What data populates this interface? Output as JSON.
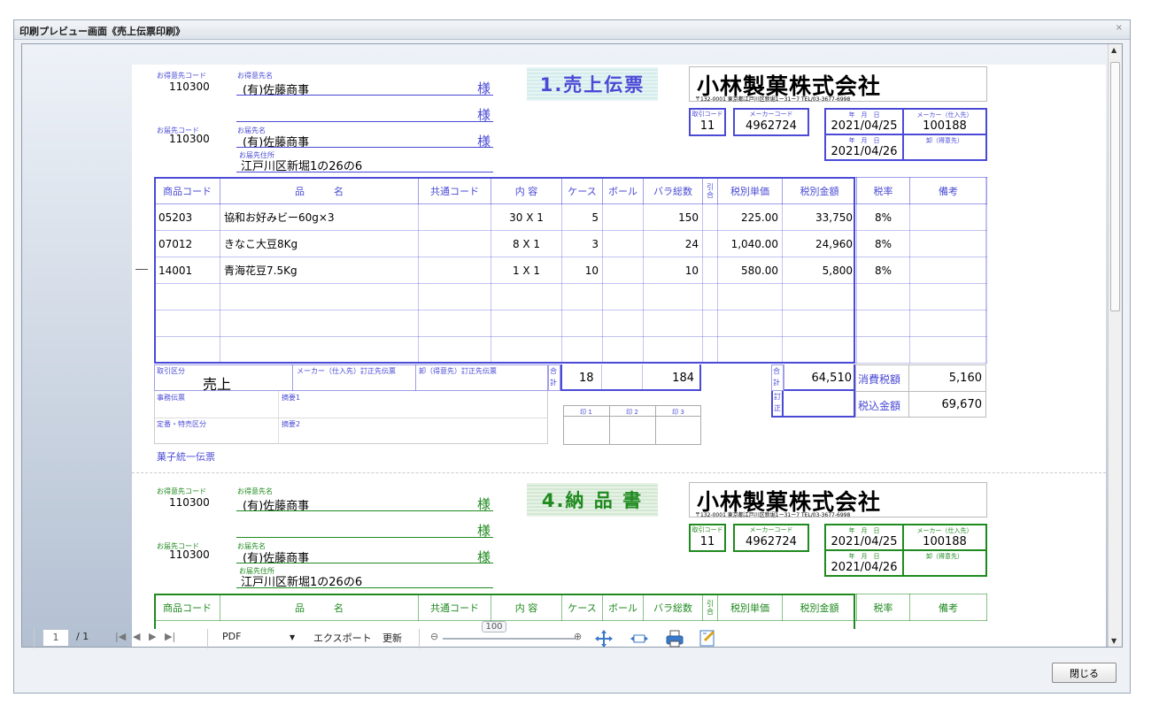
{
  "window": {
    "title": "印刷プレビュー画面《売上伝票印刷》",
    "close_icon": "×"
  },
  "slip1": {
    "color": "#4a4ad6",
    "title": "1.売上伝票",
    "tokuisaki_code_label": "お得意先コード",
    "tokuisaki_code": "110300",
    "tokuisaki_name_label": "お得意先名",
    "tokuisaki_name": "(有)佐藤商事",
    "sama": "様",
    "todoke_code_label": "お届先コード",
    "todoke_code": "110300",
    "todoke_name_label": "お届先名",
    "todoke_name": "(有)佐藤商事",
    "todoke_address_label": "お届先住所",
    "todoke_address": "江戸川区新堀1の26の6",
    "company_name": "小林製菓株式会社",
    "company_address": "〒132-0001 東京都江戸川区新堀1ー31ー7 TEL/03-3677-6998",
    "torihiki_code_label": "取引コード",
    "torihiki_code": "11",
    "maker_code_label": "メーカーコード",
    "maker_code": "4962724",
    "date_label": "年　月　日",
    "date1": "2021/04/25",
    "date2": "2021/04/26",
    "maker_shiire_label": "メーカー（仕入先）",
    "maker_shiire": "100188",
    "oroshi_label": "卸（得意先）",
    "headers": [
      "商品コード",
      "品　　　名",
      "共通コード",
      "内 容",
      "ケース",
      "ボール",
      "バラ総数",
      "引合",
      "税別単価",
      "税別金額",
      "税率",
      "備考"
    ],
    "rows": [
      {
        "code": "05203",
        "name": "協和お好みビー60g×3",
        "common": "",
        "content": "30 X 1",
        "case": "5",
        "ball": "",
        "bara": "150",
        "hiki": "",
        "unit_price": "225.00",
        "amount": "33,750",
        "rate": "8%",
        "note": ""
      },
      {
        "code": "07012",
        "name": "きなこ大豆8Kg",
        "common": "",
        "content": "8 X 1",
        "case": "3",
        "ball": "",
        "bara": "24",
        "hiki": "",
        "unit_price": "1,040.00",
        "amount": "24,960",
        "rate": "8%",
        "note": ""
      },
      {
        "code": "14001",
        "name": "青海花豆7.5Kg",
        "common": "",
        "content": "1 X 1",
        "case": "10",
        "ball": "",
        "bara": "10",
        "hiki": "",
        "unit_price": "580.00",
        "amount": "5,800",
        "rate": "8%",
        "note": ""
      }
    ],
    "torihiki_kubun_label": "取引区分",
    "torihiki_kubun": "売上",
    "maker_teisei_label": "メーカー（仕入先）訂正先伝票",
    "oroshi_teisei_label": "卸（得意先）訂正先伝票",
    "gokei_label": "合計",
    "total_case": "18",
    "total_bara": "184",
    "total_amount": "64,510",
    "teisei_label": "訂正",
    "tax_label": "消費税額",
    "tax": "5,160",
    "total_incl_label": "税込金額",
    "total_incl": "69,670",
    "jimu_label": "事務伝票",
    "tekiyou1_label": "摘要1",
    "teiban_label": "定番・特売区分",
    "tekiyou2_label": "摘要2",
    "stamps": [
      "印 1",
      "印 2",
      "印 3"
    ],
    "footer": "菓子統一伝票"
  },
  "slip2": {
    "color": "#1f8a1f",
    "title": "4.納 品 書",
    "tokuisaki_code_label": "お得意先コード",
    "tokuisaki_code": "110300",
    "tokuisaki_name_label": "お得意先名",
    "tokuisaki_name": "(有)佐藤商事",
    "sama": "様",
    "todoke_code_label": "お届先コード",
    "todoke_code": "110300",
    "todoke_name_label": "お届先名",
    "todoke_name": "(有)佐藤商事",
    "todoke_address_label": "お届先住所",
    "todoke_address": "江戸川区新堀1の26の6",
    "company_name": "小林製菓株式会社",
    "company_address": "〒132-0001 東京都江戸川区新堀1ー31ー7 TEL/03-3677-6998",
    "torihiki_code_label": "取引コード",
    "torihiki_code": "11",
    "maker_code_label": "メーカーコード",
    "maker_code": "4962724",
    "date_label": "年　月　日",
    "date1": "2021/04/25",
    "date2": "2021/04/26",
    "maker_shiire_label": "メーカー（仕入先）",
    "maker_shiire": "100188",
    "oroshi_label": "卸（得意先）",
    "headers": [
      "商品コード",
      "品　　　名",
      "共通コード",
      "内 容",
      "ケース",
      "ボール",
      "バラ総数",
      "引合",
      "税別単価",
      "税別金額",
      "税率",
      "備考"
    ]
  },
  "toolbar": {
    "page_current": "1",
    "page_total": "/ 1",
    "first_icon": "|◀",
    "prev_icon": "◀",
    "next_icon": "▶",
    "last_icon": "▶|",
    "format": "PDF",
    "dropdown_icon": "▼",
    "export_label": "エクスポート",
    "refresh_label": "更新",
    "zoom": "100",
    "zoom_out_icon": "⊖",
    "zoom_in_icon": "⊕"
  },
  "close_button": "閉じる"
}
